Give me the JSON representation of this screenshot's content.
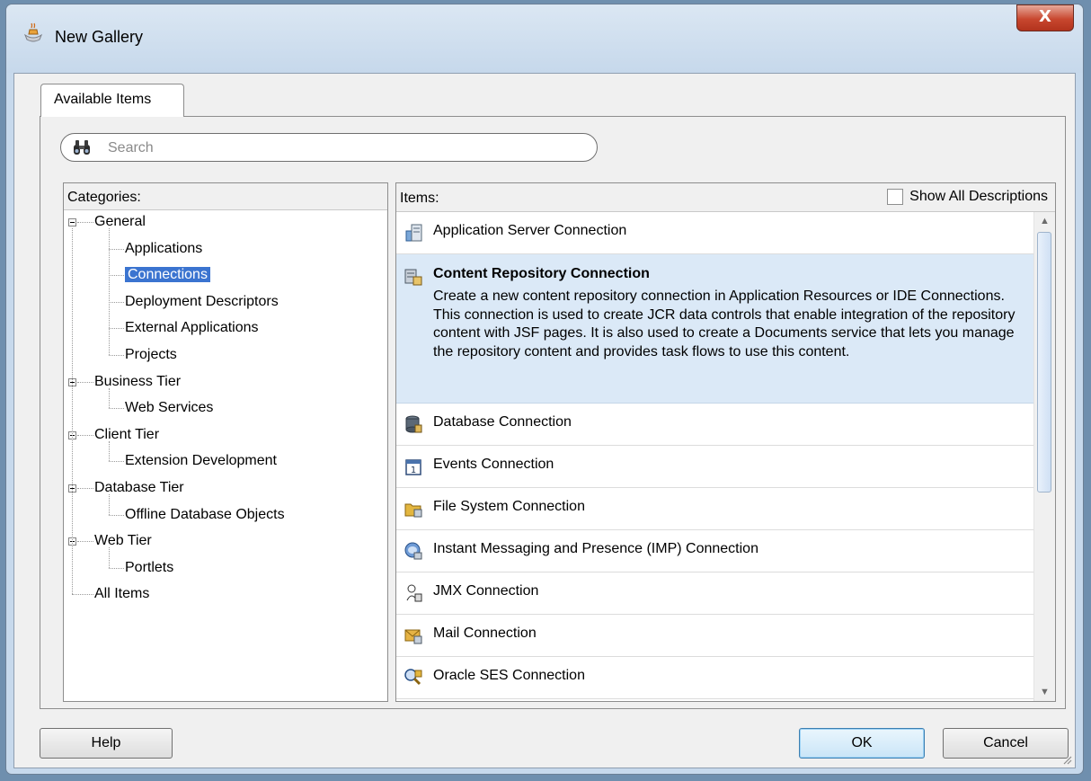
{
  "window": {
    "title": "New Gallery",
    "close_label": "X"
  },
  "tab": {
    "label": "Available Items"
  },
  "search": {
    "placeholder": "Search"
  },
  "categories": {
    "header": "Categories:",
    "tree": [
      {
        "label": "General",
        "level": 0,
        "expanded": true
      },
      {
        "label": "Applications",
        "level": 1
      },
      {
        "label": "Connections",
        "level": 1,
        "selected": true
      },
      {
        "label": "Deployment Descriptors",
        "level": 1
      },
      {
        "label": "External Applications",
        "level": 1
      },
      {
        "label": "Projects",
        "level": 1
      },
      {
        "label": "Business Tier",
        "level": 0,
        "expanded": true
      },
      {
        "label": "Web Services",
        "level": 1
      },
      {
        "label": "Client Tier",
        "level": 0,
        "expanded": true
      },
      {
        "label": "Extension Development",
        "level": 1
      },
      {
        "label": "Database Tier",
        "level": 0,
        "expanded": true
      },
      {
        "label": "Offline Database Objects",
        "level": 1
      },
      {
        "label": "Web Tier",
        "level": 0,
        "expanded": true
      },
      {
        "label": "Portlets",
        "level": 1
      },
      {
        "label": "All Items",
        "level": 0
      }
    ]
  },
  "items": {
    "header": "Items:",
    "show_all_label": "Show All Descriptions",
    "show_all_checked": false,
    "list": [
      {
        "name": "Application Server Connection",
        "icon": "server-icon"
      },
      {
        "name": "Content Repository Connection",
        "icon": "content-repository-icon",
        "selected": true,
        "description": "Create a new content repository connection in Application Resources or IDE Connections. This connection is used to create JCR data controls that enable integration of the repository content with JSF pages. It is also used to create a Documents service that lets you manage the repository content and provides task flows to use this content."
      },
      {
        "name": "Database Connection",
        "icon": "database-icon"
      },
      {
        "name": "Events Connection",
        "icon": "calendar-icon"
      },
      {
        "name": "File System Connection",
        "icon": "folder-icon"
      },
      {
        "name": "Instant Messaging and Presence (IMP) Connection",
        "icon": "messaging-icon"
      },
      {
        "name": "JMX Connection",
        "icon": "jmx-icon"
      },
      {
        "name": "Mail Connection",
        "icon": "mail-icon"
      },
      {
        "name": "Oracle SES Connection",
        "icon": "search-server-icon"
      }
    ]
  },
  "buttons": {
    "help": "Help",
    "ok": "OK",
    "cancel": "Cancel"
  }
}
